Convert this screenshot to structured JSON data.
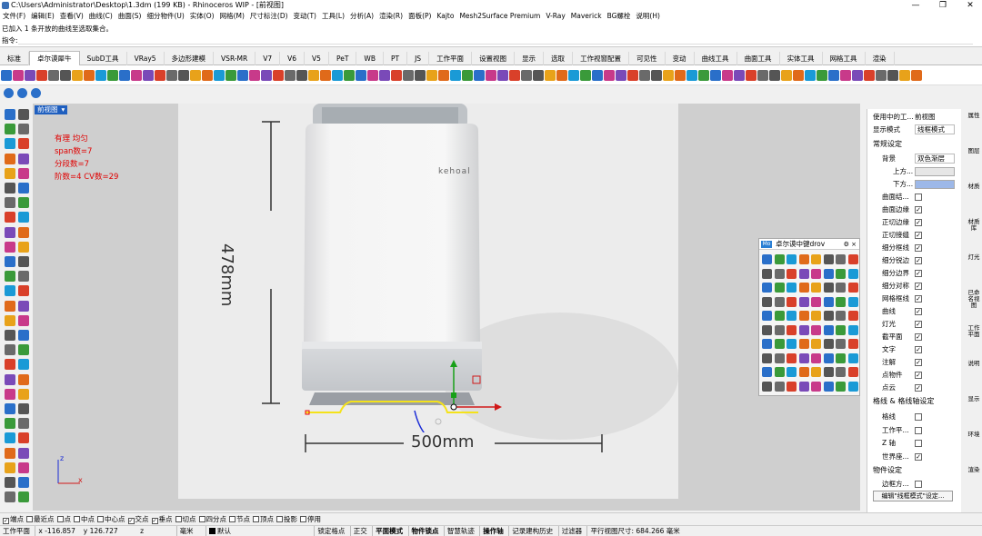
{
  "titlebar": {
    "title": "C:\\Users\\Administrator\\Desktop\\1.3dm (199 KB) - Rhinoceros WIP - [前视图]",
    "min": "—",
    "max": "❐",
    "close": "✕"
  },
  "menu": [
    "文件(F)",
    "编辑(E)",
    "查看(V)",
    "曲线(C)",
    "曲面(S)",
    "细分物件(U)",
    "实体(O)",
    "网格(M)",
    "尺寸标注(D)",
    "变动(T)",
    "工具(L)",
    "分析(A)",
    "渲染(R)",
    "面板(P)",
    "Kajto",
    "Mesh2Surface Premium",
    "V-Ray",
    "Maverick",
    "BG螺栓",
    "说明(H)"
  ],
  "command": {
    "history": "已加入 1 条开放的曲线至选取集合。",
    "prompt": "指令:"
  },
  "tabs": [
    "标准",
    "卓尔谟犀牛",
    "SubD工具",
    "VRay5",
    "多边形建模",
    "VSR-MR",
    "V7",
    "V6",
    "V5",
    "PeT",
    "WB",
    "PT",
    "JS",
    "工作平面",
    "设置视图",
    "显示",
    "选取",
    "工作视窗配置",
    "可见性",
    "变动",
    "曲线工具",
    "曲面工具",
    "实体工具",
    "网格工具",
    "渲染"
  ],
  "active_tab": "卓尔谟犀牛",
  "viewport": {
    "label": "前视图",
    "notes": [
      "有理  均匀",
      "span数=7",
      "分段数=7",
      "阶数=4   CV数=29"
    ],
    "brand": "kehoal",
    "height_dim": "478mm",
    "width_dim": "500mm",
    "axis_z": "z",
    "axis_x": "x"
  },
  "floatpanel": {
    "title": "卓尔谟中键drov",
    "badge": "Mo"
  },
  "rightpanel": {
    "rows": [
      {
        "label": "使用中的工...",
        "value": "前视图"
      },
      {
        "label": "显示模式",
        "value": "线框模式"
      }
    ],
    "general_head": "常规设定",
    "bg_label": "背景",
    "bg_value": "双色渐层",
    "top_label": "上方...",
    "bottom_label": "下方...",
    "checks": [
      {
        "label": "曲面结...",
        "checked": false
      },
      {
        "label": "曲面边缘",
        "checked": true
      },
      {
        "label": "正切边缘",
        "checked": true
      },
      {
        "label": "正切接缝",
        "checked": true
      },
      {
        "label": "细分框线",
        "checked": true
      },
      {
        "label": "细分锐边",
        "checked": true
      },
      {
        "label": "细分边界",
        "checked": true
      },
      {
        "label": "细分对称",
        "checked": true
      },
      {
        "label": "网格框线",
        "checked": true
      },
      {
        "label": "曲线",
        "checked": true
      },
      {
        "label": "灯光",
        "checked": true
      },
      {
        "label": "截平面",
        "checked": true
      },
      {
        "label": "文字",
        "checked": true
      },
      {
        "label": "注解",
        "checked": true
      },
      {
        "label": "点物件",
        "checked": true
      },
      {
        "label": "点云",
        "checked": true
      }
    ],
    "grid_head": "格线 & 格线轴设定",
    "grid_checks": [
      {
        "label": "格线",
        "checked": false
      },
      {
        "label": "工作平...",
        "checked": false
      },
      {
        "label": "Z 轴",
        "checked": false
      },
      {
        "label": "世界座...",
        "checked": true
      }
    ],
    "object_head": "物件设定",
    "object_checks": [
      {
        "label": "边框方...",
        "checked": false
      }
    ],
    "edit_button": "编辑\"线框模式\"设定..."
  },
  "sidetabs": [
    "属性",
    "图层",
    "材质",
    "材质库",
    "灯光",
    "已命名视图",
    "工作平面",
    "说明",
    "显示",
    "环境",
    "渲染"
  ],
  "osnap": [
    {
      "label": "端点",
      "checked": true
    },
    {
      "label": "最近点",
      "checked": false
    },
    {
      "label": "点",
      "checked": false
    },
    {
      "label": "中点",
      "checked": false
    },
    {
      "label": "中心点",
      "checked": false
    },
    {
      "label": "交点",
      "checked": true
    },
    {
      "label": "垂点",
      "checked": true
    },
    {
      "label": "切点",
      "checked": false
    },
    {
      "label": "四分点",
      "checked": false
    },
    {
      "label": "节点",
      "checked": false
    },
    {
      "label": "顶点",
      "checked": false
    },
    {
      "label": "投影",
      "checked": false
    },
    {
      "label": "停用",
      "checked": false
    }
  ],
  "status": {
    "plane": "工作平面",
    "x": "x -116.857",
    "y": "y 126.727",
    "z": "z",
    "unit": "毫米",
    "layer": "默认",
    "lock": "锁定格点",
    "ortho": "正交",
    "planar": "平面模式",
    "osnap": "物件锁点",
    "smarttrack": "智慧轨迹",
    "gumball": "操作轴",
    "history": "记录建构历史",
    "filter": "过滤器",
    "viewsize": "平行视图尺寸: 684.266 毫米"
  }
}
